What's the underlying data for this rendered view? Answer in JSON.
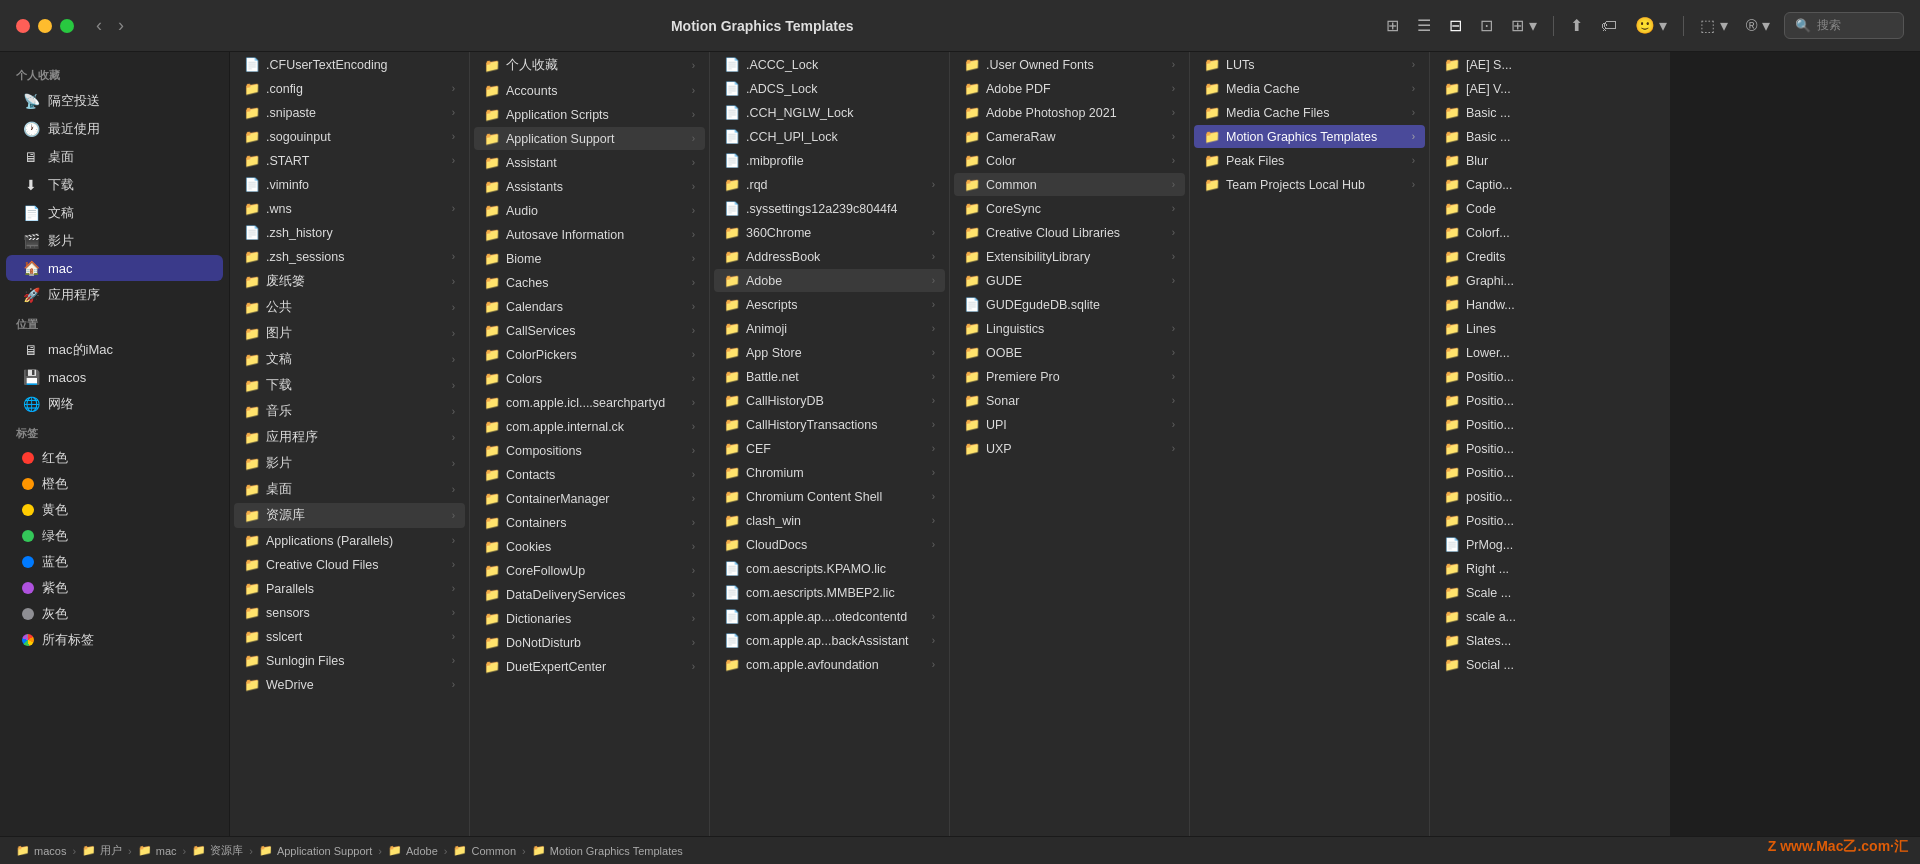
{
  "window": {
    "title": "Motion Graphics Templates"
  },
  "toolbar": {
    "view_icons": [
      "⊞",
      "☰",
      "⊟",
      "⊡",
      "⊞"
    ],
    "search_placeholder": "搜索"
  },
  "sidebar": {
    "section_favorites": "个人收藏",
    "favorites": [
      {
        "id": "airdrop",
        "icon": "📡",
        "label": "隔空投送"
      },
      {
        "id": "recents",
        "icon": "🕐",
        "label": "最近使用"
      },
      {
        "id": "desktop",
        "icon": "🖥",
        "label": "桌面"
      },
      {
        "id": "downloads",
        "icon": "⬇",
        "label": "下载"
      },
      {
        "id": "documents",
        "icon": "📄",
        "label": "文稿"
      },
      {
        "id": "movies",
        "icon": "🎬",
        "label": "影片"
      },
      {
        "id": "mac",
        "icon": "🏠",
        "label": "mac",
        "active": true
      }
    ],
    "section_apps": "",
    "apps": [
      {
        "id": "applications",
        "icon": "🚀",
        "label": "应用程序"
      }
    ],
    "section_locations": "位置",
    "locations": [
      {
        "id": "mac-imac",
        "icon": "🖥",
        "label": "mac的iMac"
      },
      {
        "id": "macos",
        "icon": "💾",
        "label": "macos"
      },
      {
        "id": "network",
        "icon": "🌐",
        "label": "网络"
      }
    ],
    "section_tags": "标签",
    "tags": [
      {
        "id": "red",
        "color": "#ff3b30",
        "label": "红色"
      },
      {
        "id": "orange",
        "color": "#ff9500",
        "label": "橙色"
      },
      {
        "id": "yellow",
        "color": "#ffcc00",
        "label": "黄色"
      },
      {
        "id": "green",
        "color": "#34c759",
        "label": "绿色"
      },
      {
        "id": "blue",
        "color": "#007aff",
        "label": "蓝色"
      },
      {
        "id": "purple",
        "color": "#af52de",
        "label": "紫色"
      },
      {
        "id": "gray",
        "color": "#8e8e93",
        "label": "灰色"
      },
      {
        "id": "all-tags",
        "color": null,
        "label": "所有标签"
      }
    ]
  },
  "col1": {
    "items": [
      {
        "name": ".CFUserTextEncoding",
        "type": "file",
        "hasArrow": false
      },
      {
        "name": ".config",
        "type": "folder",
        "hasArrow": true
      },
      {
        "name": ".snipaste",
        "type": "folder",
        "hasArrow": true
      },
      {
        "name": ".sogouinput",
        "type": "folder",
        "hasArrow": true
      },
      {
        "name": ".START",
        "type": "folder",
        "hasArrow": true
      },
      {
        "name": ".viminfo",
        "type": "file",
        "hasArrow": false
      },
      {
        "name": ".wns",
        "type": "folder",
        "hasArrow": true
      },
      {
        "name": ".zsh_history",
        "type": "file",
        "hasArrow": false
      },
      {
        "name": ".zsh_sessions",
        "type": "folder",
        "hasArrow": true
      },
      {
        "name": "废纸篓",
        "type": "folder",
        "hasArrow": true
      },
      {
        "name": "公共",
        "type": "folder",
        "hasArrow": true
      },
      {
        "name": "图片",
        "type": "folder",
        "hasArrow": true
      },
      {
        "name": "文稿",
        "type": "folder",
        "hasArrow": true
      },
      {
        "name": "下载",
        "type": "folder",
        "hasArrow": true
      },
      {
        "name": "音乐",
        "type": "folder",
        "hasArrow": true
      },
      {
        "name": "应用程序",
        "type": "folder",
        "hasArrow": true
      },
      {
        "name": "影片",
        "type": "folder",
        "hasArrow": true
      },
      {
        "name": "桌面",
        "type": "folder",
        "hasArrow": true
      },
      {
        "name": "资源库",
        "type": "folder",
        "hasArrow": true,
        "selectedParent": true
      },
      {
        "name": "Applications (Parallels)",
        "type": "folder",
        "hasArrow": true
      },
      {
        "name": "Creative Cloud Files",
        "type": "folder",
        "hasArrow": true
      },
      {
        "name": "Parallels",
        "type": "folder",
        "hasArrow": true
      },
      {
        "name": "sensors",
        "type": "folder",
        "hasArrow": true
      },
      {
        "name": "sslcert",
        "type": "folder",
        "hasArrow": true
      },
      {
        "name": "Sunlogin Files",
        "type": "folder",
        "hasArrow": true
      },
      {
        "name": "WeDrive",
        "type": "folder",
        "hasArrow": true
      }
    ]
  },
  "col2": {
    "items": [
      {
        "name": "个人收藏",
        "type": "folder",
        "hasArrow": true
      },
      {
        "name": "Accounts",
        "type": "folder",
        "hasArrow": true
      },
      {
        "name": "Application Scripts",
        "type": "folder",
        "hasArrow": true
      },
      {
        "name": "Application Support",
        "type": "folder",
        "hasArrow": true,
        "selectedParent": true
      },
      {
        "name": "Assistant",
        "type": "folder",
        "hasArrow": true
      },
      {
        "name": "Assistants",
        "type": "folder",
        "hasArrow": true
      },
      {
        "name": "Audio",
        "type": "folder",
        "hasArrow": true
      },
      {
        "name": "Autosave Information",
        "type": "folder",
        "hasArrow": true
      },
      {
        "name": "Biome",
        "type": "folder",
        "hasArrow": true
      },
      {
        "name": "Caches",
        "type": "folder",
        "hasArrow": true
      },
      {
        "name": "Calendars",
        "type": "folder",
        "hasArrow": true
      },
      {
        "name": "CallServices",
        "type": "folder",
        "hasArrow": true
      },
      {
        "name": "ColorPickers",
        "type": "folder",
        "hasArrow": true
      },
      {
        "name": "Colors",
        "type": "folder",
        "hasArrow": true
      },
      {
        "name": "com.apple.icl....searchpartyd",
        "type": "folder",
        "hasArrow": true
      },
      {
        "name": "com.apple.internal.ck",
        "type": "folder",
        "hasArrow": true
      },
      {
        "name": "Compositions",
        "type": "folder",
        "hasArrow": true
      },
      {
        "name": "Contacts",
        "type": "folder",
        "hasArrow": true
      },
      {
        "name": "ContainerManager",
        "type": "folder",
        "hasArrow": true
      },
      {
        "name": "Containers",
        "type": "folder",
        "hasArrow": true
      },
      {
        "name": "Cookies",
        "type": "folder",
        "hasArrow": true
      },
      {
        "name": "CoreFollowUp",
        "type": "folder",
        "hasArrow": true
      },
      {
        "name": "DataDeliveryServices",
        "type": "folder",
        "hasArrow": true
      },
      {
        "name": "Dictionaries",
        "type": "folder",
        "hasArrow": true
      },
      {
        "name": "DoNotDisturb",
        "type": "folder",
        "hasArrow": true
      },
      {
        "name": "DuetExpertCenter",
        "type": "folder",
        "hasArrow": true
      }
    ]
  },
  "col3": {
    "items": [
      {
        "name": ".ACCC_Lock",
        "type": "file",
        "hasArrow": false
      },
      {
        "name": ".ADCS_Lock",
        "type": "file",
        "hasArrow": false
      },
      {
        "name": ".CCH_NGLW_Lock",
        "type": "file",
        "hasArrow": false
      },
      {
        "name": ".CCH_UPI_Lock",
        "type": "file",
        "hasArrow": false
      },
      {
        "name": ".mibprofile",
        "type": "file",
        "hasArrow": false
      },
      {
        "name": ".rqd",
        "type": "folder",
        "hasArrow": true
      },
      {
        "name": ".syssettings12a239c8044f4",
        "type": "file",
        "hasArrow": false
      },
      {
        "name": "360Chrome",
        "type": "folder",
        "hasArrow": true
      },
      {
        "name": "AddressBook",
        "type": "folder",
        "hasArrow": true
      },
      {
        "name": "Adobe",
        "type": "folder",
        "hasArrow": true,
        "selectedParent": true
      },
      {
        "name": "Aescripts",
        "type": "folder",
        "hasArrow": true
      },
      {
        "name": "Animoji",
        "type": "folder",
        "hasArrow": true
      },
      {
        "name": "App Store",
        "type": "folder",
        "hasArrow": true
      },
      {
        "name": "Battle.net",
        "type": "folder",
        "hasArrow": true
      },
      {
        "name": "CallHistoryDB",
        "type": "folder",
        "hasArrow": true
      },
      {
        "name": "CallHistoryTransactions",
        "type": "folder",
        "hasArrow": true
      },
      {
        "name": "CEF",
        "type": "folder",
        "hasArrow": true
      },
      {
        "name": "Chromium",
        "type": "folder",
        "hasArrow": true
      },
      {
        "name": "Chromium Content Shell",
        "type": "folder",
        "hasArrow": true
      },
      {
        "name": "clash_win",
        "type": "folder",
        "hasArrow": true
      },
      {
        "name": "CloudDocs",
        "type": "folder",
        "hasArrow": true
      },
      {
        "name": "com.aescripts.KPAMO.lic",
        "type": "file",
        "hasArrow": false
      },
      {
        "name": "com.aescripts.MMBEP2.lic",
        "type": "file",
        "hasArrow": false
      },
      {
        "name": "com.apple.ap....otedcontentd",
        "type": "file",
        "hasArrow": true
      },
      {
        "name": "com.apple.ap...backAssistant",
        "type": "file",
        "hasArrow": true
      },
      {
        "name": "com.apple.avfoundation",
        "type": "folder",
        "hasArrow": true
      }
    ]
  },
  "col4": {
    "items": [
      {
        "name": ".User Owned Fonts",
        "type": "folder",
        "hasArrow": true
      },
      {
        "name": "Adobe PDF",
        "type": "folder",
        "hasArrow": true
      },
      {
        "name": "Adobe Photoshop 2021",
        "type": "folder",
        "hasArrow": true
      },
      {
        "name": "CameraRaw",
        "type": "folder",
        "hasArrow": true
      },
      {
        "name": "Color",
        "type": "folder",
        "hasArrow": true
      },
      {
        "name": "Common",
        "type": "folder",
        "hasArrow": true,
        "selectedParent": true
      },
      {
        "name": "CoreSync",
        "type": "folder",
        "hasArrow": true
      },
      {
        "name": "Creative Cloud Libraries",
        "type": "folder",
        "hasArrow": true
      },
      {
        "name": "ExtensibilityLibrary",
        "type": "folder",
        "hasArrow": true
      },
      {
        "name": "GUDE",
        "type": "folder",
        "hasArrow": true
      },
      {
        "name": "GUDEgudeDB.sqlite",
        "type": "file",
        "hasArrow": false
      },
      {
        "name": "Linguistics",
        "type": "folder",
        "hasArrow": true
      },
      {
        "name": "OOBE",
        "type": "folder",
        "hasArrow": true
      },
      {
        "name": "Premiere Pro",
        "type": "folder",
        "hasArrow": true
      },
      {
        "name": "Sonar",
        "type": "folder",
        "hasArrow": true
      },
      {
        "name": "UPI",
        "type": "folder",
        "hasArrow": true
      },
      {
        "name": "UXP",
        "type": "folder",
        "hasArrow": true
      }
    ]
  },
  "col5": {
    "items": [
      {
        "name": "LUTs",
        "type": "folder",
        "hasArrow": true
      },
      {
        "name": "Media Cache",
        "type": "folder",
        "hasArrow": true
      },
      {
        "name": "Media Cache Files",
        "type": "folder",
        "hasArrow": true
      },
      {
        "name": "Motion Graphics Templates",
        "type": "folder",
        "hasArrow": true,
        "selected": true
      },
      {
        "name": "Peak Files",
        "type": "folder",
        "hasArrow": true
      },
      {
        "name": "Team Projects Local Hub",
        "type": "folder",
        "hasArrow": true
      }
    ]
  },
  "col6": {
    "items": [
      {
        "name": "[AE] S...",
        "type": "folder",
        "hasArrow": false
      },
      {
        "name": "[AE] V...",
        "type": "folder",
        "hasArrow": false
      },
      {
        "name": "Basic ...",
        "type": "folder",
        "hasArrow": false
      },
      {
        "name": "Basic ...",
        "type": "folder",
        "hasArrow": false
      },
      {
        "name": "Blur",
        "type": "folder",
        "hasArrow": false
      },
      {
        "name": "Captio...",
        "type": "folder",
        "hasArrow": false
      },
      {
        "name": "Code",
        "type": "folder",
        "hasArrow": false
      },
      {
        "name": "Colorf...",
        "type": "folder",
        "hasArrow": false
      },
      {
        "name": "Credits",
        "type": "folder",
        "hasArrow": false
      },
      {
        "name": "Graphi...",
        "type": "folder",
        "hasArrow": false
      },
      {
        "name": "Handw...",
        "type": "folder",
        "hasArrow": false
      },
      {
        "name": "Lines",
        "type": "folder",
        "hasArrow": false
      },
      {
        "name": "Lower...",
        "type": "folder",
        "hasArrow": false
      },
      {
        "name": "Positio...",
        "type": "folder",
        "hasArrow": false
      },
      {
        "name": "Positio...",
        "type": "folder",
        "hasArrow": false
      },
      {
        "name": "Positio...",
        "type": "folder",
        "hasArrow": false
      },
      {
        "name": "Positio...",
        "type": "folder",
        "hasArrow": false
      },
      {
        "name": "Positio...",
        "type": "folder",
        "hasArrow": false
      },
      {
        "name": "positio...",
        "type": "folder",
        "hasArrow": false
      },
      {
        "name": "Positio...",
        "type": "folder",
        "hasArrow": false
      },
      {
        "name": "PrMog...",
        "type": "file",
        "hasArrow": false
      },
      {
        "name": "Right ...",
        "type": "folder",
        "hasArrow": false
      },
      {
        "name": "Scale ...",
        "type": "folder",
        "hasArrow": false
      },
      {
        "name": "scale a...",
        "type": "folder",
        "hasArrow": false
      },
      {
        "name": "Slates...",
        "type": "folder",
        "hasArrow": false
      },
      {
        "name": "Social ...",
        "type": "folder",
        "hasArrow": false
      }
    ]
  },
  "statusbar": {
    "breadcrumbs": [
      "macos",
      "用户",
      "mac",
      "资源库",
      "Application Support",
      "Adobe",
      "Common",
      "Motion Graphics Templates"
    ]
  },
  "watermark": "Z www.Mac乙.com·汇"
}
